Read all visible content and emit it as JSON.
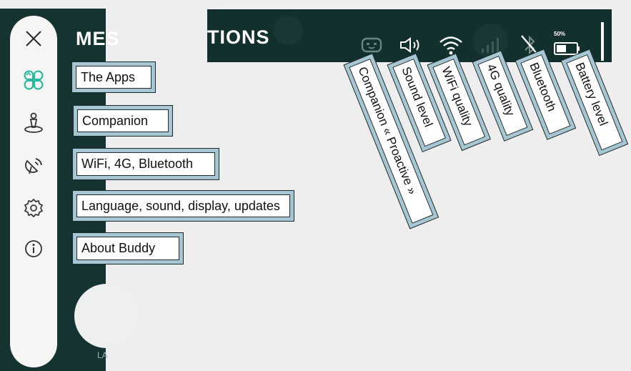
{
  "header": {
    "title_left": "MES",
    "title_right": "TIONS"
  },
  "background": {
    "bottom_label": "LA"
  },
  "sidebar": {
    "items": [
      {
        "icon": "close-icon"
      },
      {
        "icon": "apps-icon"
      },
      {
        "icon": "companion-icon"
      },
      {
        "icon": "connectivity-icon"
      },
      {
        "icon": "settings-icon"
      },
      {
        "icon": "info-icon"
      }
    ]
  },
  "callouts": {
    "apps": "The Apps",
    "companion": "Companion",
    "connectivity": "WiFi, 4G, Bluetooth",
    "settings": "Language, sound, display, updates",
    "about": "About Buddy"
  },
  "status_callouts": {
    "companion": "Companion « Proactive »",
    "sound": "Sound level",
    "wifi": "WiFi quality",
    "cell": "4G quality",
    "bluetooth": "Bluetooth",
    "battery": "Battery level"
  },
  "status": {
    "battery_percent": "50%"
  },
  "colors": {
    "app_dark": "#143331",
    "accent": "#2bb9a0",
    "callout_border": "#a7c6d3"
  }
}
